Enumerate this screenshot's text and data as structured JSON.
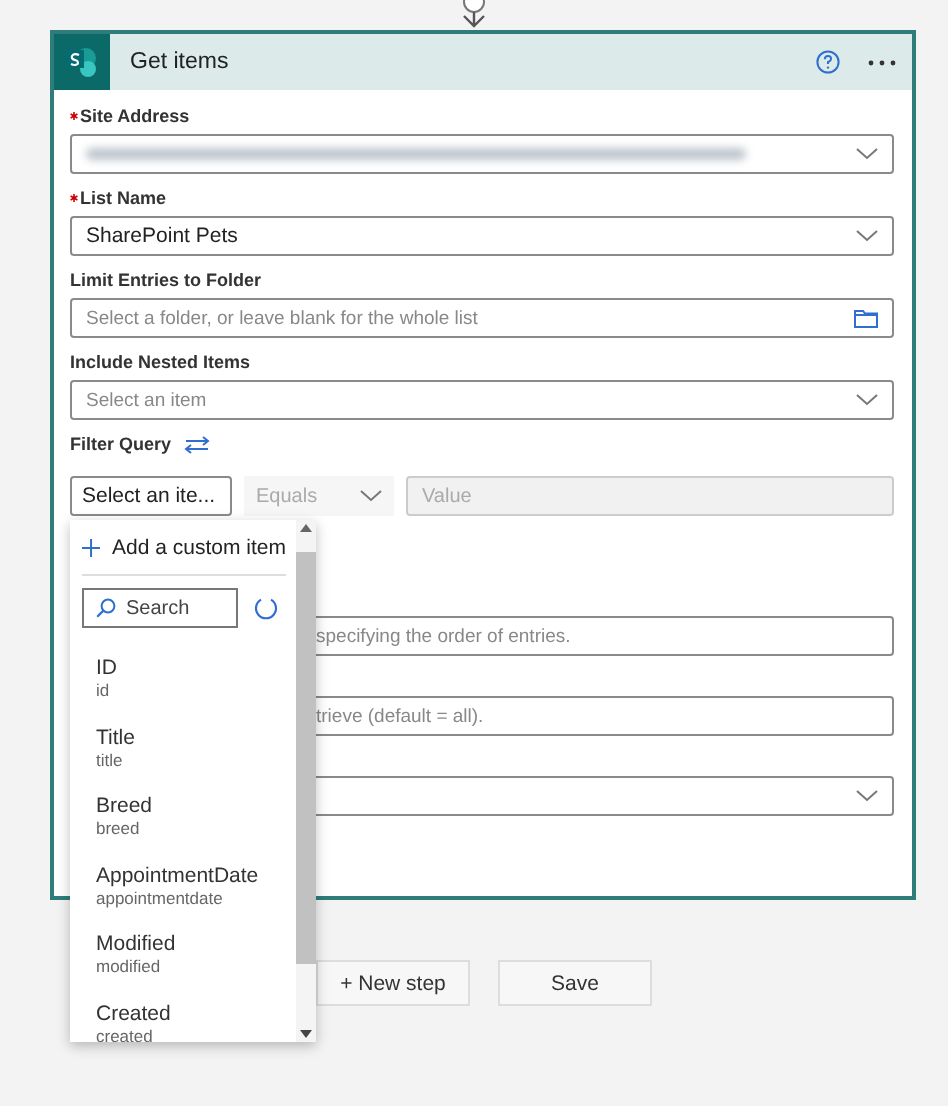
{
  "card": {
    "title": "Get items",
    "fields": [
      {
        "kind": "dropdown",
        "label": "Site Address",
        "required": true,
        "blurred": true
      },
      {
        "kind": "dropdown",
        "label": "List Name",
        "required": true,
        "value": "SharePoint Pets"
      },
      {
        "kind": "folder",
        "label": "Limit Entries to Folder",
        "required": false,
        "placeholder": "Select a folder, or leave blank for the whole list"
      },
      {
        "kind": "dropdown",
        "label": "Include Nested Items",
        "required": false,
        "placeholder": "Select an item"
      },
      {
        "kind": "filter",
        "label": "Filter Query",
        "required": false,
        "item": "Select an ite...",
        "operator": "Equals",
        "value_placeholder": "Value"
      },
      {
        "kind": "text",
        "placeholder": "specifying the order of entries."
      },
      {
        "kind": "text",
        "placeholder": "trieve (default = all)."
      },
      {
        "kind": "dropdown"
      }
    ]
  },
  "popup": {
    "add_item": "Add a custom item",
    "search_placeholder": "Search",
    "items": [
      {
        "name": "ID",
        "key": "id"
      },
      {
        "name": "Title",
        "key": "title"
      },
      {
        "name": "Breed",
        "key": "breed"
      },
      {
        "name": "AppointmentDate",
        "key": "appointmentdate"
      },
      {
        "name": "Modified",
        "key": "modified"
      },
      {
        "name": "Created",
        "key": "created"
      }
    ]
  },
  "buttons": [
    "+ New step",
    "Save"
  ]
}
